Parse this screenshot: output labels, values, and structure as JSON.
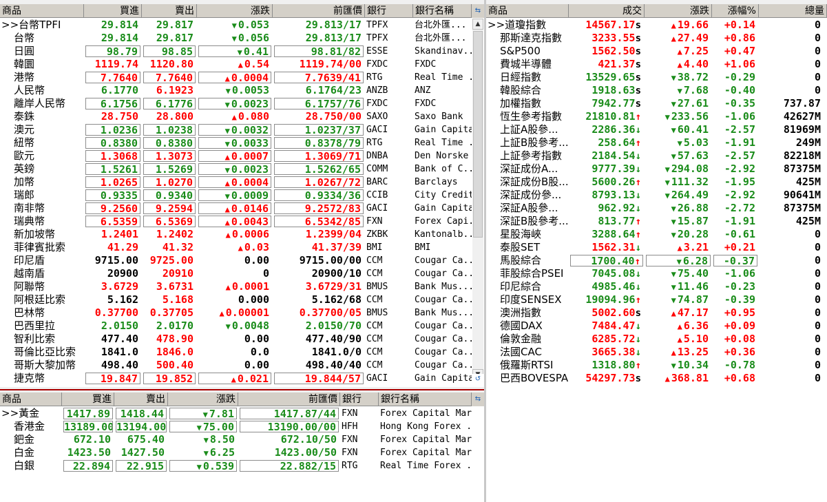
{
  "forex": {
    "headers": [
      "商品",
      "買進",
      "賣出",
      "漲跌",
      "前匯價",
      "銀行",
      "銀行名稱"
    ],
    "rows": [
      {
        "name": ">>台幣TPFI",
        "bid": "29.814",
        "ask": "29.817",
        "chg": "0.053",
        "dir": "down",
        "prev": "29.813/17",
        "bank": "TPFX",
        "bank_name": "台北外匯...",
        "bc": "g",
        "ac": "g",
        "cc": "g",
        "pc": "g",
        "box": false,
        "sel": true
      },
      {
        "name": "台幣",
        "bid": "29.814",
        "ask": "29.817",
        "chg": "0.056",
        "dir": "down",
        "prev": "29.813/17",
        "bank": "TPFX",
        "bank_name": "台北外匯...",
        "bc": "g",
        "ac": "g",
        "cc": "g",
        "pc": "g",
        "box": false
      },
      {
        "name": "日圓",
        "bid": "98.79",
        "ask": "98.85",
        "chg": "0.41",
        "dir": "down",
        "prev": "98.81/82",
        "bank": "ESSE",
        "bank_name": "Skandinav...",
        "bc": "g",
        "ac": "g",
        "cc": "g",
        "pc": "g",
        "box": true
      },
      {
        "name": "韓圜",
        "bid": "1119.74",
        "ask": "1120.80",
        "chg": "0.54",
        "dir": "up",
        "prev": "1119.74/00",
        "bank": "FXDC",
        "bank_name": "FXDC",
        "bc": "r",
        "ac": "r",
        "cc": "r",
        "pc": "r",
        "box": false
      },
      {
        "name": "港幣",
        "bid": "7.7640",
        "ask": "7.7640",
        "chg": "0.0004",
        "dir": "up",
        "prev": "7.7639/41",
        "bank": "RTG",
        "bank_name": "Real Time ...",
        "bc": "r",
        "ac": "r",
        "cc": "r",
        "pc": "r",
        "box": true
      },
      {
        "name": "人民幣",
        "bid": "6.1770",
        "ask": "6.1923",
        "chg": "0.0053",
        "dir": "down",
        "prev": "6.1764/23",
        "bank": "ANZB",
        "bank_name": "ANZ",
        "bc": "g",
        "ac": "r",
        "cc": "g",
        "pc": "g",
        "box": false
      },
      {
        "name": "離岸人民幣",
        "bid": "6.1756",
        "ask": "6.1776",
        "chg": "0.0023",
        "dir": "down",
        "prev": "6.1757/76",
        "bank": "FXDC",
        "bank_name": "FXDC",
        "bc": "g",
        "ac": "g",
        "cc": "g",
        "pc": "g",
        "box": true
      },
      {
        "name": "泰銖",
        "bid": "28.750",
        "ask": "28.800",
        "chg": "0.080",
        "dir": "up",
        "prev": "28.750/00",
        "bank": "SAXO",
        "bank_name": "Saxo Bank",
        "bc": "r",
        "ac": "r",
        "cc": "r",
        "pc": "r",
        "box": false
      },
      {
        "name": "澳元",
        "bid": "1.0236",
        "ask": "1.0238",
        "chg": "0.0032",
        "dir": "down",
        "prev": "1.0237/37",
        "bank": "GACI",
        "bank_name": "Gain Capital",
        "bc": "g",
        "ac": "g",
        "cc": "g",
        "pc": "g",
        "box": true
      },
      {
        "name": "紐幣",
        "bid": "0.8380",
        "ask": "0.8380",
        "chg": "0.0033",
        "dir": "down",
        "prev": "0.8378/79",
        "bank": "RTG",
        "bank_name": "Real Time ...",
        "bc": "g",
        "ac": "g",
        "cc": "g",
        "pc": "g",
        "box": true
      },
      {
        "name": "歐元",
        "bid": "1.3068",
        "ask": "1.3073",
        "chg": "0.0007",
        "dir": "up",
        "prev": "1.3069/71",
        "bank": "DNBA",
        "bank_name": "Den Norske",
        "bc": "r",
        "ac": "r",
        "cc": "r",
        "pc": "r",
        "box": true
      },
      {
        "name": "英鎊",
        "bid": "1.5261",
        "ask": "1.5269",
        "chg": "0.0023",
        "dir": "down",
        "prev": "1.5262/65",
        "bank": "COMM",
        "bank_name": "Bank of C...",
        "bc": "g",
        "ac": "g",
        "cc": "g",
        "pc": "g",
        "box": true
      },
      {
        "name": "加幣",
        "bid": "1.0265",
        "ask": "1.0270",
        "chg": "0.0004",
        "dir": "up",
        "prev": "1.0267/72",
        "bank": "BARC",
        "bank_name": "Barclays",
        "bc": "r",
        "ac": "r",
        "cc": "r",
        "pc": "r",
        "box": true
      },
      {
        "name": "瑞郎",
        "bid": "0.9335",
        "ask": "0.9340",
        "chg": "0.0009",
        "dir": "down",
        "prev": "0.9334/36",
        "bank": "CCIB",
        "bank_name": "City Credit...",
        "bc": "g",
        "ac": "g",
        "cc": "g",
        "pc": "g",
        "box": true
      },
      {
        "name": "南非幣",
        "bid": "9.2560",
        "ask": "9.2594",
        "chg": "0.0146",
        "dir": "up",
        "prev": "9.2572/83",
        "bank": "GACI",
        "bank_name": "Gain Capital",
        "bc": "r",
        "ac": "r",
        "cc": "r",
        "pc": "r",
        "box": true
      },
      {
        "name": "瑞典幣",
        "bid": "6.5359",
        "ask": "6.5369",
        "chg": "0.0043",
        "dir": "up",
        "prev": "6.5342/85",
        "bank": "FXN",
        "bank_name": "Forex Capi...",
        "bc": "r",
        "ac": "r",
        "cc": "r",
        "pc": "r",
        "box": true
      },
      {
        "name": "新加坡幣",
        "bid": "1.2401",
        "ask": "1.2402",
        "chg": "0.0006",
        "dir": "up",
        "prev": "1.2399/04",
        "bank": "ZKBK",
        "bank_name": "Kantonalb...",
        "bc": "r",
        "ac": "r",
        "cc": "r",
        "pc": "r",
        "box": false
      },
      {
        "name": "菲律賓批索",
        "bid": "41.29",
        "ask": "41.32",
        "chg": "0.03",
        "dir": "up",
        "prev": "41.37/39",
        "bank": "BMI",
        "bank_name": "BMI",
        "bc": "r",
        "ac": "r",
        "cc": "r",
        "pc": "r",
        "box": false
      },
      {
        "name": "印尼盾",
        "bid": "9715.00",
        "ask": "9725.00",
        "chg": "0.00",
        "dir": "none",
        "prev": "9715.00/00",
        "bank": "CCM",
        "bank_name": "Cougar Ca...",
        "bc": "k",
        "ac": "r",
        "cc": "k",
        "pc": "k",
        "box": false
      },
      {
        "name": "越南盾",
        "bid": "20900",
        "ask": "20910",
        "chg": "0",
        "dir": "none",
        "prev": "20900/10",
        "bank": "CCM",
        "bank_name": "Cougar Ca...",
        "bc": "k",
        "ac": "r",
        "cc": "k",
        "pc": "k",
        "box": false
      },
      {
        "name": "阿聯幣",
        "bid": "3.6729",
        "ask": "3.6731",
        "chg": "0.0001",
        "dir": "up",
        "prev": "3.6729/31",
        "bank": "BMUS",
        "bank_name": "Bank Mus...",
        "bc": "r",
        "ac": "r",
        "cc": "r",
        "pc": "r",
        "box": false
      },
      {
        "name": "阿根廷比索",
        "bid": "5.162",
        "ask": "5.168",
        "chg": "0.000",
        "dir": "none",
        "prev": "5.162/68",
        "bank": "CCM",
        "bank_name": "Cougar Ca...",
        "bc": "k",
        "ac": "r",
        "cc": "k",
        "pc": "k",
        "box": false
      },
      {
        "name": "巴林幣",
        "bid": "0.37700",
        "ask": "0.37705",
        "chg": "0.00001",
        "dir": "up",
        "prev": "0.37700/05",
        "bank": "BMUS",
        "bank_name": "Bank Mus...",
        "bc": "r",
        "ac": "r",
        "cc": "r",
        "pc": "r",
        "box": false
      },
      {
        "name": "巴西里拉",
        "bid": "2.0150",
        "ask": "2.0170",
        "chg": "0.0048",
        "dir": "down",
        "prev": "2.0150/70",
        "bank": "CCM",
        "bank_name": "Cougar Ca...",
        "bc": "g",
        "ac": "g",
        "cc": "g",
        "pc": "g",
        "box": false
      },
      {
        "name": "智利比索",
        "bid": "477.40",
        "ask": "478.90",
        "chg": "0.00",
        "dir": "none",
        "prev": "477.40/90",
        "bank": "CCM",
        "bank_name": "Cougar Ca...",
        "bc": "k",
        "ac": "r",
        "cc": "k",
        "pc": "k",
        "box": false
      },
      {
        "name": "哥倫比亞比索",
        "bid": "1841.0",
        "ask": "1846.0",
        "chg": "0.0",
        "dir": "none",
        "prev": "1841.0/0",
        "bank": "CCM",
        "bank_name": "Cougar Ca...",
        "bc": "k",
        "ac": "r",
        "cc": "k",
        "pc": "k",
        "box": false
      },
      {
        "name": "哥斯大黎加幣",
        "bid": "498.40",
        "ask": "500.40",
        "chg": "0.00",
        "dir": "none",
        "prev": "498.40/40",
        "bank": "CCM",
        "bank_name": "Cougar Ca...",
        "bc": "k",
        "ac": "r",
        "cc": "k",
        "pc": "k",
        "box": false
      },
      {
        "name": "捷克幣",
        "bid": "19.847",
        "ask": "19.852",
        "chg": "0.021",
        "dir": "up",
        "prev": "19.844/57",
        "bank": "GACI",
        "bank_name": "Gain Capital",
        "bc": "r",
        "ac": "r",
        "cc": "r",
        "pc": "r",
        "box": true
      }
    ]
  },
  "metals": {
    "headers": [
      "商品",
      "買進",
      "賣出",
      "漲跌",
      "前匯價",
      "銀行",
      "銀行名稱"
    ],
    "rows": [
      {
        "name": ">>黃金",
        "bid": "1417.89",
        "ask": "1418.44",
        "chg": "7.81",
        "dir": "down",
        "prev": "1417.87/44",
        "bank": "FXN",
        "bank_name": "Forex Capital Mar...",
        "bc": "g",
        "ac": "g",
        "cc": "g",
        "pc": "g",
        "box": true,
        "sel": true
      },
      {
        "name": "香港金",
        "bid": "13189.00",
        "ask": "13194.00",
        "chg": "75.00",
        "dir": "down",
        "prev": "13190.00/00",
        "bank": "HFH",
        "bank_name": "Hong Kong Forex ...",
        "bc": "g",
        "ac": "g",
        "cc": "g",
        "pc": "g",
        "box": true
      },
      {
        "name": "鈀金",
        "bid": "672.10",
        "ask": "675.40",
        "chg": "8.50",
        "dir": "down",
        "prev": "672.10/50",
        "bank": "FXN",
        "bank_name": "Forex Capital Mar...",
        "bc": "g",
        "ac": "g",
        "cc": "g",
        "pc": "g",
        "box": false
      },
      {
        "name": "白金",
        "bid": "1423.50",
        "ask": "1427.50",
        "chg": "6.25",
        "dir": "down",
        "prev": "1423.00/50",
        "bank": "FXN",
        "bank_name": "Forex Capital Mar...",
        "bc": "g",
        "ac": "g",
        "cc": "g",
        "pc": "g",
        "box": false
      },
      {
        "name": "白銀",
        "bid": "22.894",
        "ask": "22.915",
        "chg": "0.539",
        "dir": "down",
        "prev": "22.882/15",
        "bank": "RTG",
        "bank_name": "Real Time Forex ...",
        "bc": "g",
        "ac": "g",
        "cc": "g",
        "pc": "g",
        "box": true
      }
    ]
  },
  "indices": {
    "headers": [
      "商品",
      "成交",
      "漲跌",
      "漲幅%",
      "總量"
    ],
    "rows": [
      {
        "name": ">>道瓊指數",
        "price": "14567.17",
        "mark": "s",
        "chg": "19.66",
        "dir": "up",
        "pct": "+0.14",
        "vol": "0",
        "pcol": "r",
        "ccol": "r",
        "sel": true
      },
      {
        "name": "那斯達克指數",
        "price": "3233.55",
        "mark": "s",
        "chg": "27.49",
        "dir": "up",
        "pct": "+0.86",
        "vol": "0",
        "pcol": "r",
        "ccol": "r"
      },
      {
        "name": "S&P500",
        "price": "1562.50",
        "mark": "s",
        "chg": "7.25",
        "dir": "up",
        "pct": "+0.47",
        "vol": "0",
        "pcol": "r",
        "ccol": "r"
      },
      {
        "name": "費城半導體",
        "price": "421.37",
        "mark": "s",
        "chg": "4.40",
        "dir": "up",
        "pct": "+1.06",
        "vol": "0",
        "pcol": "r",
        "ccol": "r"
      },
      {
        "name": "日經指數",
        "price": "13529.65",
        "mark": "s",
        "chg": "38.72",
        "dir": "down",
        "pct": "-0.29",
        "vol": "0",
        "pcol": "g",
        "ccol": "g"
      },
      {
        "name": "韓股綜合",
        "price": "1918.63",
        "mark": "s",
        "chg": "7.68",
        "dir": "down",
        "pct": "-0.40",
        "vol": "0",
        "pcol": "g",
        "ccol": "g"
      },
      {
        "name": "加權指數",
        "price": "7942.77",
        "mark": "s",
        "chg": "27.61",
        "dir": "down",
        "pct": "-0.35",
        "vol": "737.87",
        "pcol": "g",
        "ccol": "g"
      },
      {
        "name": "恆生參考指數",
        "price": "21810.81",
        "mark": "↑",
        "chg": "233.56",
        "dir": "down",
        "pct": "-1.06",
        "vol": "42627M",
        "pcol": "g",
        "ccol": "g"
      },
      {
        "name": "上証A股參...",
        "price": "2286.36",
        "mark": "↓",
        "chg": "60.41",
        "dir": "down",
        "pct": "-2.57",
        "vol": "81969M",
        "pcol": "g",
        "ccol": "g"
      },
      {
        "name": "上証B股參考...",
        "price": "258.64",
        "mark": "↑",
        "chg": "5.03",
        "dir": "down",
        "pct": "-1.91",
        "vol": "249M",
        "pcol": "g",
        "ccol": "g"
      },
      {
        "name": "上証參考指數",
        "price": "2184.54",
        "mark": "↓",
        "chg": "57.63",
        "dir": "down",
        "pct": "-2.57",
        "vol": "82218M",
        "pcol": "g",
        "ccol": "g"
      },
      {
        "name": "深証成份A...",
        "price": "9777.39",
        "mark": "↓",
        "chg": "294.08",
        "dir": "down",
        "pct": "-2.92",
        "vol": "87375M",
        "pcol": "g",
        "ccol": "g"
      },
      {
        "name": "深証成份B股...",
        "price": "5600.26",
        "mark": "↑",
        "chg": "111.32",
        "dir": "down",
        "pct": "-1.95",
        "vol": "425M",
        "pcol": "g",
        "ccol": "g"
      },
      {
        "name": "深証成份參...",
        "price": "8793.13",
        "mark": "↓",
        "chg": "264.49",
        "dir": "down",
        "pct": "-2.92",
        "vol": "90641M",
        "pcol": "g",
        "ccol": "g"
      },
      {
        "name": "深証A股參...",
        "price": "962.92",
        "mark": "↓",
        "chg": "26.88",
        "dir": "down",
        "pct": "-2.72",
        "vol": "87375M",
        "pcol": "g",
        "ccol": "g"
      },
      {
        "name": "深証B股參考...",
        "price": "813.77",
        "mark": "↑",
        "chg": "15.87",
        "dir": "down",
        "pct": "-1.91",
        "vol": "425M",
        "pcol": "g",
        "ccol": "g"
      },
      {
        "name": "星股海峽",
        "price": "3288.64",
        "mark": "↑",
        "chg": "20.28",
        "dir": "down",
        "pct": "-0.61",
        "vol": "0",
        "pcol": "g",
        "ccol": "g"
      },
      {
        "name": "泰股SET",
        "price": "1562.31",
        "mark": "↓",
        "chg": "3.21",
        "dir": "up",
        "pct": "+0.21",
        "vol": "0",
        "pcol": "r",
        "ccol": "r"
      },
      {
        "name": "馬股綜合",
        "price": "1700.40",
        "mark": "↑",
        "chg": "6.28",
        "dir": "down",
        "pct": "-0.37",
        "vol": "0",
        "pcol": "g",
        "ccol": "g",
        "box": true
      },
      {
        "name": "菲股綜合PSEI",
        "price": "7045.08",
        "mark": "↓",
        "chg": "75.40",
        "dir": "down",
        "pct": "-1.06",
        "vol": "0",
        "pcol": "g",
        "ccol": "g"
      },
      {
        "name": "印尼綜合",
        "price": "4985.46",
        "mark": "↓",
        "chg": "11.46",
        "dir": "down",
        "pct": "-0.23",
        "vol": "0",
        "pcol": "g",
        "ccol": "g"
      },
      {
        "name": "印度SENSEX",
        "price": "19094.96",
        "mark": "↑",
        "chg": "74.87",
        "dir": "down",
        "pct": "-0.39",
        "vol": "0",
        "pcol": "g",
        "ccol": "g"
      },
      {
        "name": "澳洲指數",
        "price": "5002.60",
        "mark": "s",
        "chg": "47.17",
        "dir": "up",
        "pct": "+0.95",
        "vol": "0",
        "pcol": "r",
        "ccol": "r"
      },
      {
        "name": "德國DAX",
        "price": "7484.47",
        "mark": "↓",
        "chg": "6.36",
        "dir": "up",
        "pct": "+0.09",
        "vol": "0",
        "pcol": "r",
        "ccol": "r"
      },
      {
        "name": "倫敦金融",
        "price": "6285.72",
        "mark": "↓",
        "chg": "5.10",
        "dir": "up",
        "pct": "+0.08",
        "vol": "0",
        "pcol": "r",
        "ccol": "r"
      },
      {
        "name": "法國CAC",
        "price": "3665.38",
        "mark": "↓",
        "chg": "13.25",
        "dir": "up",
        "pct": "+0.36",
        "vol": "0",
        "pcol": "r",
        "ccol": "r"
      },
      {
        "name": "俄羅斯RTSI",
        "price": "1318.80",
        "mark": "↑",
        "chg": "10.34",
        "dir": "down",
        "pct": "-0.78",
        "vol": "0",
        "pcol": "g",
        "ccol": "g"
      },
      {
        "name": "巴西BOVESPA",
        "price": "54297.73",
        "mark": "s",
        "chg": "368.81",
        "dir": "up",
        "pct": "+0.68",
        "vol": "0",
        "pcol": "r",
        "ccol": "r"
      }
    ]
  },
  "icons": {
    "arrow_up": "▲",
    "arrow_down": "▼",
    "scroll_up": "▲",
    "scroll_down": "▼",
    "corner": "⇆",
    "corner_bottom": "↺"
  },
  "colors": {
    "up": "#ff0000",
    "down": "#1a8c1a",
    "neutral": "#000000",
    "header": "#d4d0c8",
    "separator": "#aa0000"
  }
}
